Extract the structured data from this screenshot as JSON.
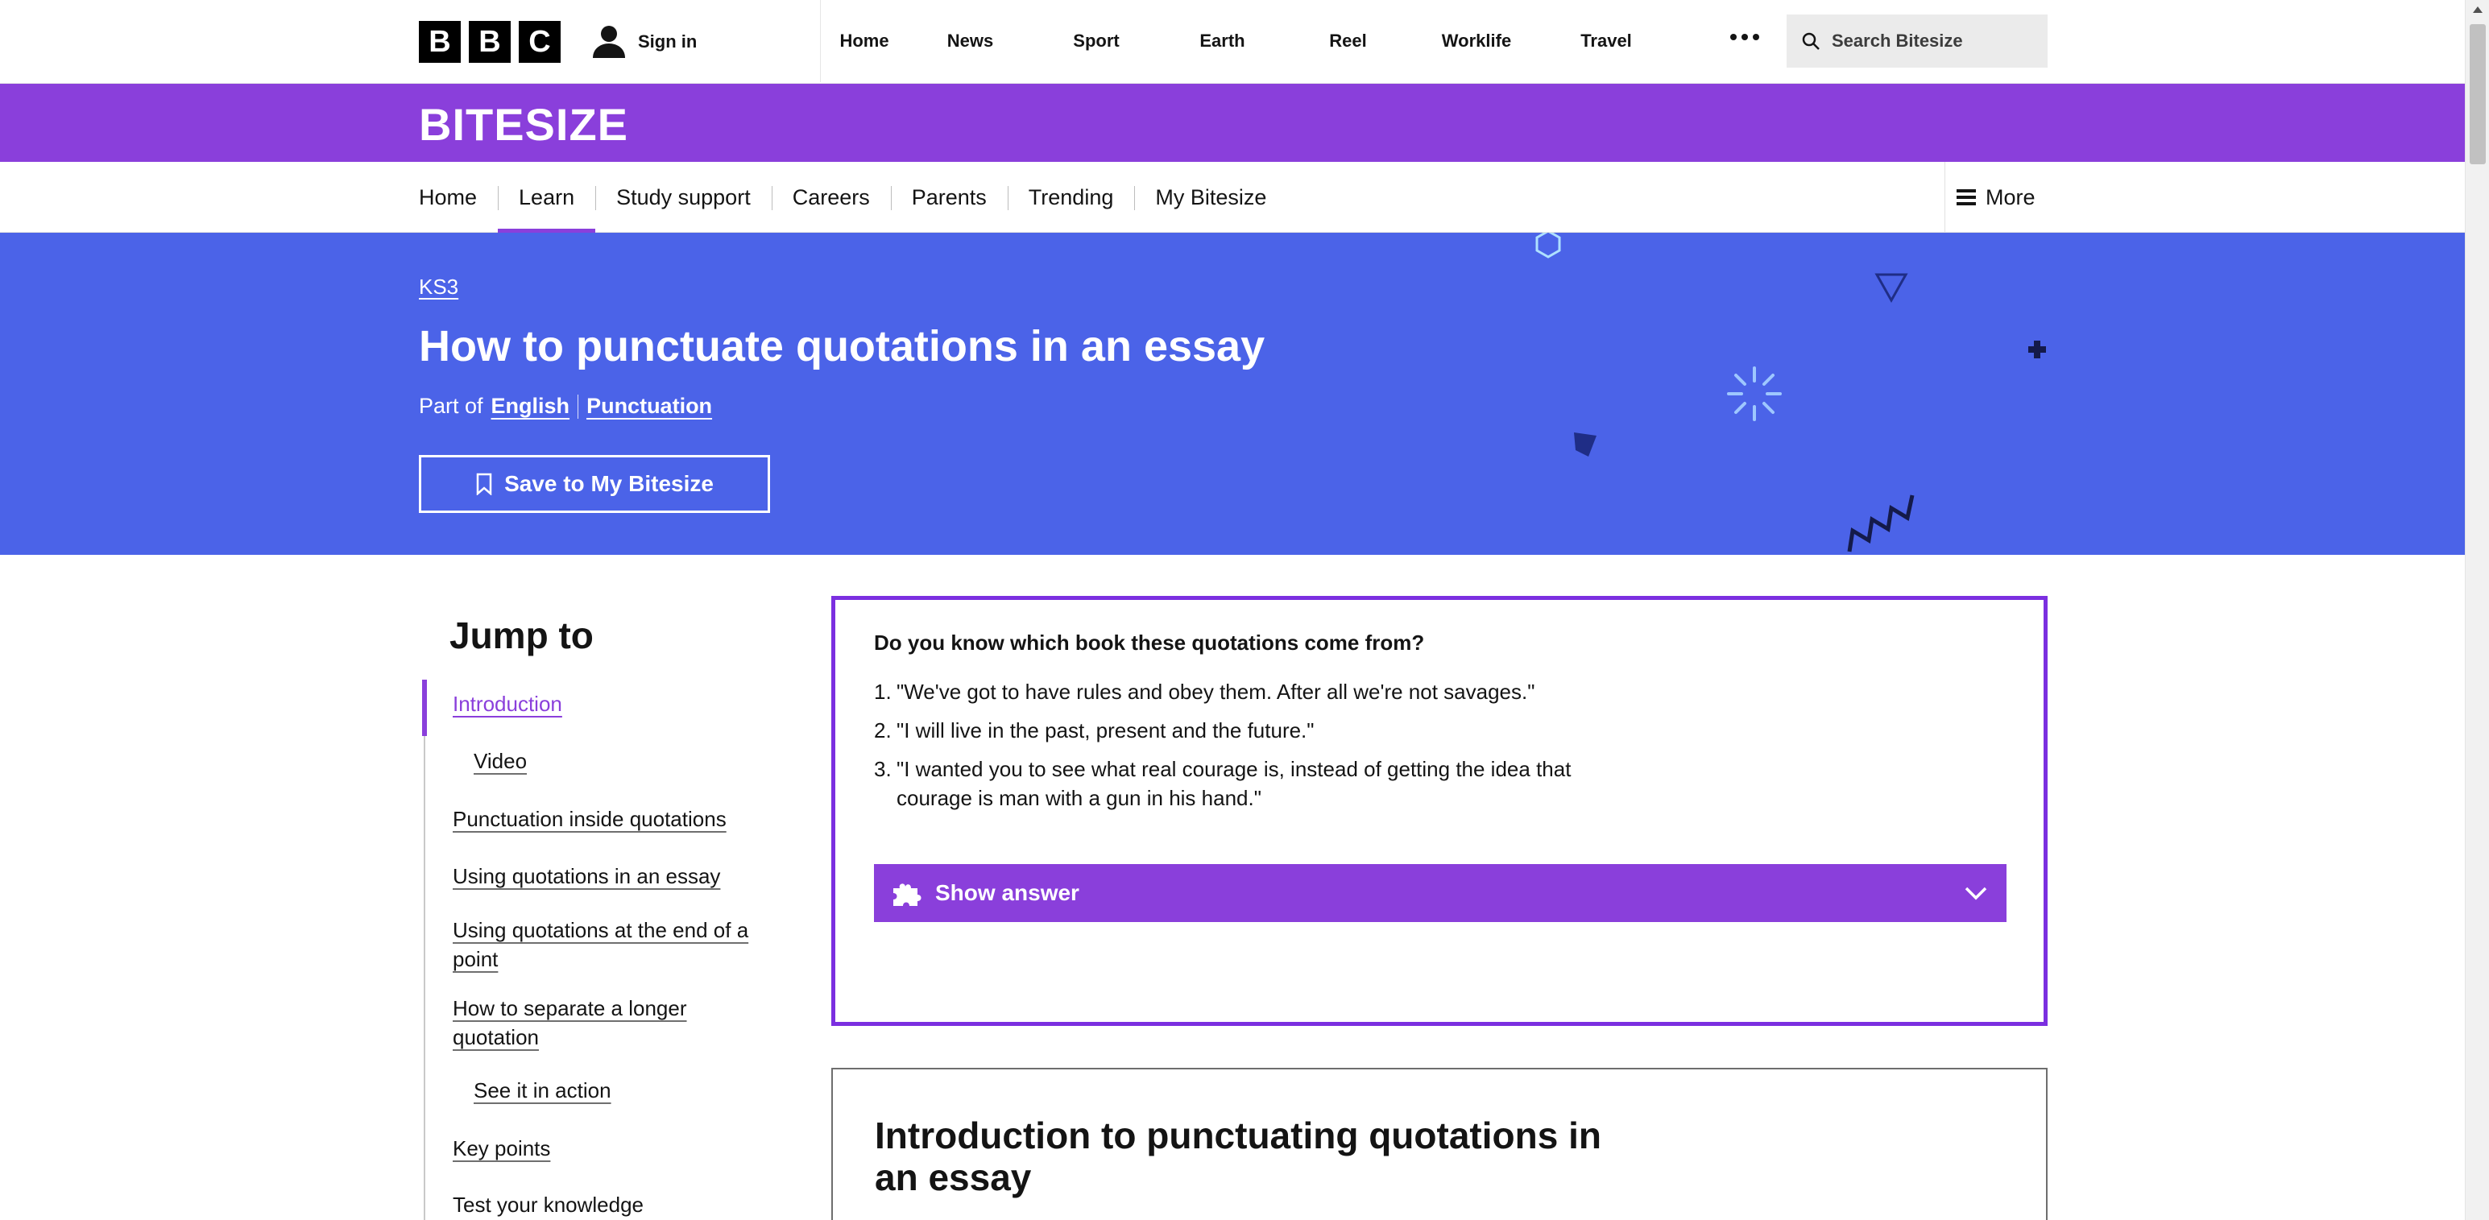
{
  "global_nav": {
    "logo_letters": [
      "B",
      "B",
      "C"
    ],
    "sign_in": "Sign in",
    "links": [
      "Home",
      "News",
      "Sport",
      "Earth",
      "Reel",
      "Worklife",
      "Travel"
    ],
    "more_icon": "ellipsis-icon",
    "search_placeholder": "Search Bitesize"
  },
  "bitesize": {
    "brand": "BITESIZE",
    "nav": [
      "Home",
      "Learn",
      "Study support",
      "Careers",
      "Parents",
      "Trending",
      "My Bitesize"
    ],
    "active_nav": "Learn",
    "more": "More"
  },
  "hero": {
    "breadcrumb": "KS3",
    "title": "How to punctuate quotations in an essay",
    "part_of_label": "Part of",
    "part_of_links": [
      "English",
      "Punctuation"
    ],
    "save_button": "Save to My Bitesize"
  },
  "jump_to": {
    "heading": "Jump to",
    "items": [
      {
        "label": "Introduction",
        "active": true,
        "sub": false
      },
      {
        "label": "Video",
        "active": false,
        "sub": true
      },
      {
        "label": "Punctuation inside quotations",
        "active": false,
        "sub": false
      },
      {
        "label": "Using quotations in an essay",
        "active": false,
        "sub": false
      },
      {
        "label": "Using quotations at the end of a",
        "label2": "point",
        "active": false,
        "sub": false
      },
      {
        "label": "How to separate a longer",
        "label2": "quotation",
        "active": false,
        "sub": false
      },
      {
        "label": "See it in action",
        "active": false,
        "sub": true
      },
      {
        "label": "Key points",
        "active": false,
        "sub": false
      },
      {
        "label": "Test your knowledge",
        "active": false,
        "sub": false
      }
    ]
  },
  "quiz": {
    "question": "Do you know which book these quotations come from?",
    "quotes": [
      {
        "num": "1.",
        "text": "\"We've got to have rules and obey them. After all we're not savages.\""
      },
      {
        "num": "2.",
        "text": "\"I will live in the past, present and the future.\""
      },
      {
        "num": "3.",
        "text": "\"I wanted you to see what real courage is, instead of getting the idea that courage is man with a gun in his hand.\""
      }
    ],
    "show_answer": "Show answer"
  },
  "intro": {
    "heading": "Introduction to punctuating quotations in an essay"
  },
  "colors": {
    "bitesize_purple": "#8a3fdb",
    "hero_blue": "#4b63e8",
    "quiz_border": "#7b2fe0"
  }
}
